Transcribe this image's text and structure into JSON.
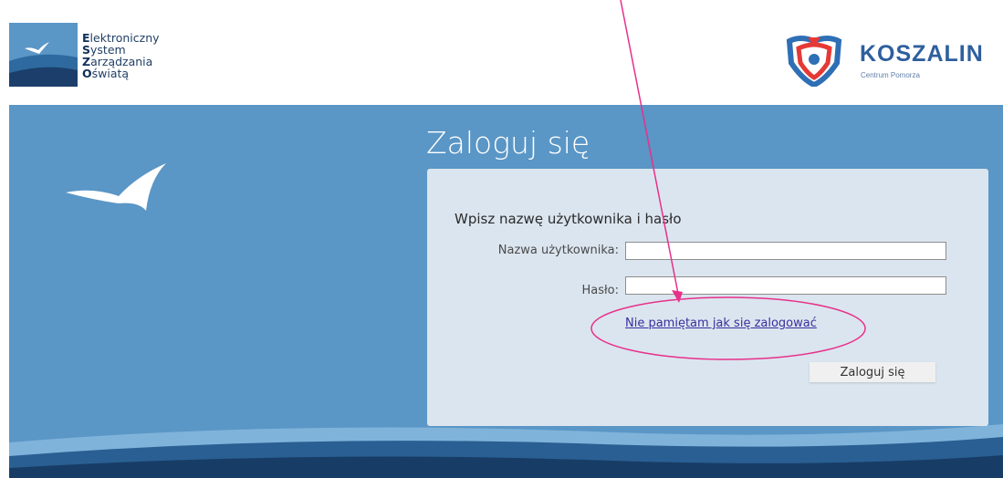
{
  "header": {
    "esoz_logo_lines": [
      "Elektroniczny",
      "System",
      "Zarządzania",
      "Oświatą"
    ],
    "koszalin_name": "KOSZALIN",
    "koszalin_sub": "Centrum Pomorza"
  },
  "main": {
    "title": "Zaloguj się",
    "prompt": "Wpisz nazwę użytkownika i hasło",
    "username_label": "Nazwa użytkownika:",
    "username_value": "",
    "password_label": "Hasło:",
    "password_value": "",
    "forgot_link": "Nie pamiętam jak się zalogować",
    "login_button": "Zaloguj się"
  },
  "colors": {
    "main_bg": "#5a96c6",
    "panel_bg": "#dbe5ef",
    "annotation": "#e8308a",
    "link": "#3a2f9e"
  },
  "icons": [
    "esoz-bird-logo-icon",
    "koszalin-crest-icon",
    "bird-icon",
    "annotation-arrow-icon",
    "annotation-ellipse-icon"
  ]
}
